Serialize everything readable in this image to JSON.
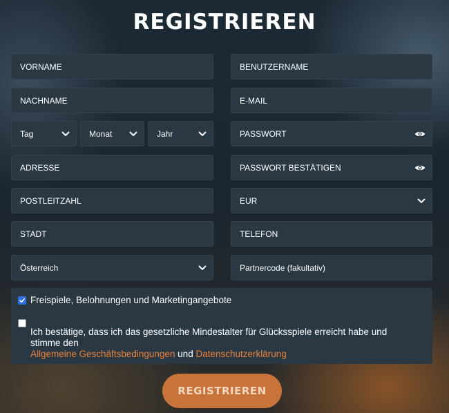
{
  "page_title": "REGISTRIEREN",
  "form": {
    "first_name": "VORNAME",
    "username": "BENUTZERNAME",
    "last_name": "NACHNAME",
    "email": "E-MAIL",
    "day": "Tag",
    "month": "Monat",
    "year": "Jahr",
    "password": "PASSWORT",
    "address": "ADRESSE",
    "password_confirm": "PASSWORT BESTÄTIGEN",
    "postal_code": "POSTLEITZAHL",
    "currency": "EUR",
    "city": "STADT",
    "phone": "TELEFON",
    "country": "Österreich",
    "partner_code": "Partnercode (fakultativ)"
  },
  "consent": {
    "marketing": {
      "checked": true,
      "label": "Freispiele, Belohnungen und Marketingangebote"
    },
    "age": {
      "checked": false,
      "text": "Ich bestätige, dass ich das gesetzliche Mindestalter für Glücksspiele erreicht habe und stimme den",
      "terms_link": "Allgemeine Geschäftsbedingungen",
      "and": "und",
      "privacy_link": "Datenschutzerklärung"
    }
  },
  "submit_label": "REGISTRIEREN",
  "colors": {
    "field_bg": "#2a3844",
    "accent": "#c8733a",
    "link": "#e8823a",
    "checkbox": "#2f6fe0"
  },
  "icons": {
    "dropdown": "chevron-down-icon",
    "password_toggle": "eye-icon"
  }
}
